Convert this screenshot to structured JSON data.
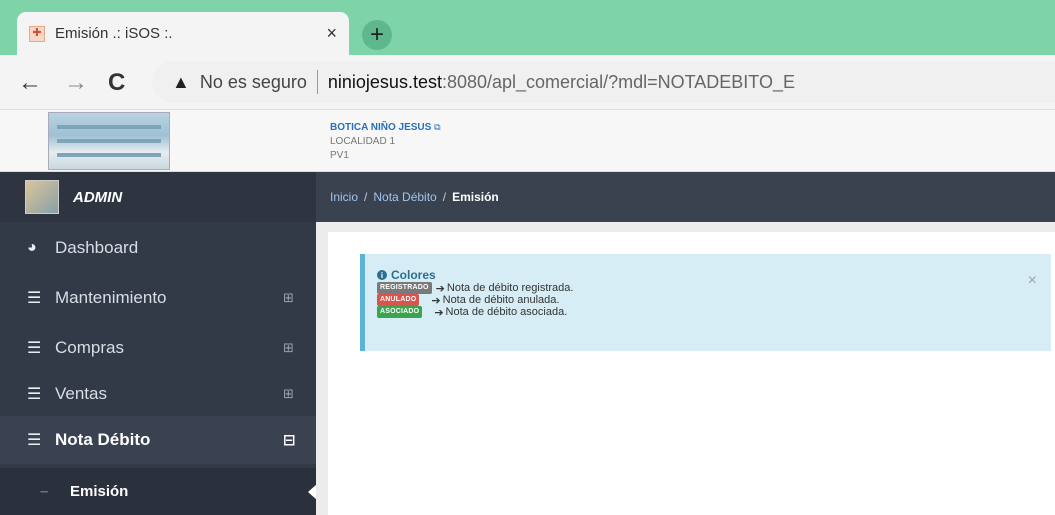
{
  "browser": {
    "tab_title": "Emisión .: iSOS :.",
    "tab_close": "×",
    "new_tab": "+",
    "back": "←",
    "forward": "→",
    "reload": "C",
    "security_label": "No es seguro",
    "url_host": "niniojesus.test",
    "url_rest": ":8080/apl_comercial/?mdl=NOTADEBITO_E"
  },
  "header": {
    "company_name": "BOTICA NIÑO JESUS",
    "location": "LOCALIDAD 1",
    "pos": "PV1"
  },
  "user": {
    "name": "ADMIN"
  },
  "breadcrumb": {
    "home": "Inicio",
    "section": "Nota Débito",
    "current": "Emisión",
    "separator": "/"
  },
  "sidebar": {
    "items": [
      {
        "label": "Dashboard",
        "icon": "dashboard-icon",
        "expander": ""
      },
      {
        "label": "Mantenimiento",
        "icon": "list-icon",
        "expander": "⊞"
      },
      {
        "label": "Compras",
        "icon": "list-icon",
        "expander": "⊞"
      },
      {
        "label": "Ventas",
        "icon": "list-icon",
        "expander": "⊞"
      },
      {
        "label": "Nota Débito",
        "icon": "list-icon",
        "expander": "⊟"
      }
    ],
    "sub_item": "Emisión"
  },
  "alert": {
    "title": "Colores",
    "close": "×",
    "legend": [
      {
        "badge": "REGISTRADO",
        "color": "#7a7a7a",
        "text": "Nota de débito registrada."
      },
      {
        "badge": "ANULADO",
        "color": "#d9534f",
        "text": "Nota de débito anulada."
      },
      {
        "badge": "ASOCIADO",
        "color": "#3aa44f",
        "text": "Nota de débito asociada."
      }
    ]
  }
}
